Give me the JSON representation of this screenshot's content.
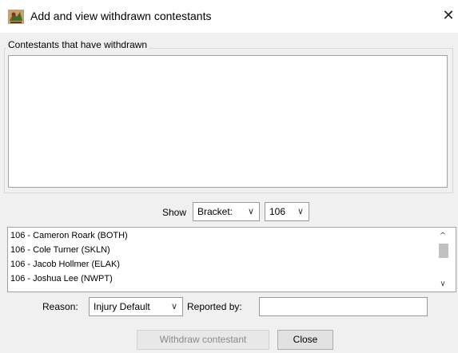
{
  "window": {
    "title": "Add and view withdrawn contestants",
    "close_glyph": "✕",
    "app_icon": "wrestler-app-icon"
  },
  "withdrawn_group": {
    "label": "Contestants that have withdrawn",
    "items": []
  },
  "filter": {
    "show_label": "Show",
    "type_value": "Bracket:",
    "bracket_value": "106",
    "chevron": "∨"
  },
  "contestants": [
    "106 - Cameron Roark (BOTH)",
    "106 - Cole Turner (SKLN)",
    "106 - Jacob Hollmer (ELAK)",
    "106 - Joshua Lee (NWPT)"
  ],
  "scrollbar": {
    "up_glyph": "^",
    "down_glyph": "∨"
  },
  "form": {
    "reason_label": "Reason:",
    "reason_value": "Injury Default",
    "reported_by_label": "Reported by:",
    "reported_by_value": ""
  },
  "buttons": {
    "withdraw_label": "Withdraw contestant",
    "close_label": "Close"
  }
}
